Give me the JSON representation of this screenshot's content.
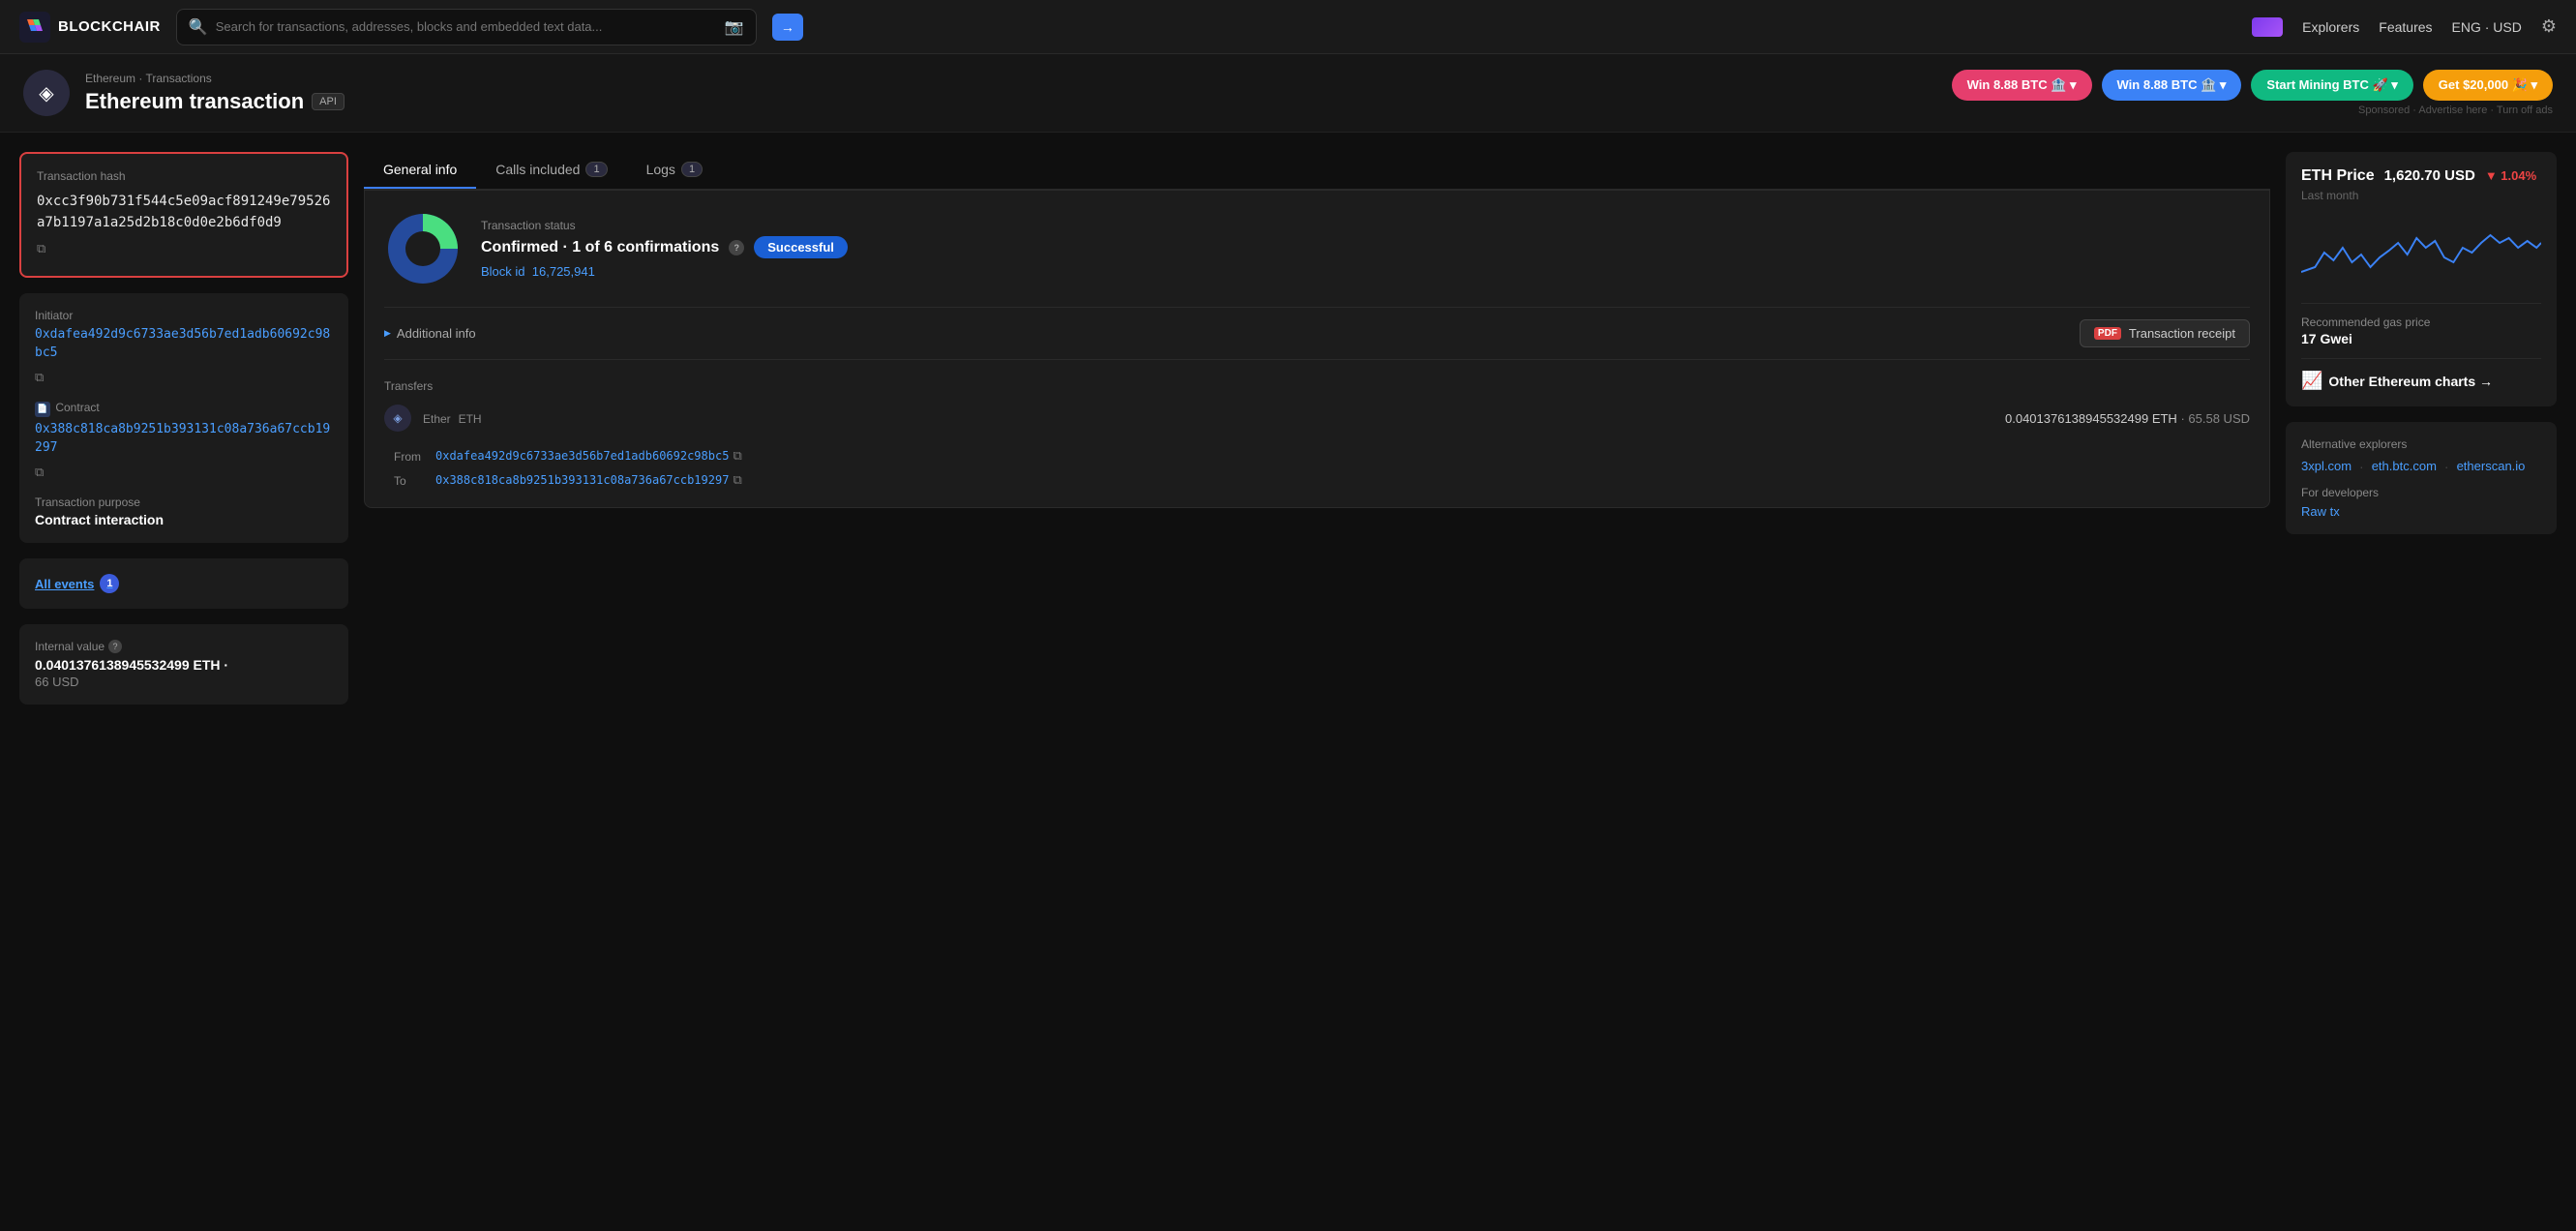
{
  "header": {
    "logo_text": "BLOCKCHAIR",
    "search_placeholder": "Search for transactions, addresses, blocks and embedded text data...",
    "search_btn_arrow": "→",
    "nav": {
      "explorers": "Explorers",
      "features": "Features",
      "lang_currency": "ENG · USD"
    }
  },
  "page_header": {
    "breadcrumb_chain": "Ethereum",
    "breadcrumb_sep": "·",
    "breadcrumb_page": "Transactions",
    "title": "Ethereum transaction",
    "api_badge": "API",
    "promo": [
      {
        "label": "Win 8.88 BTC 🏦 ▾",
        "style": "red"
      },
      {
        "label": "Win 8.88 BTC 🏦 ▾",
        "style": "blue"
      },
      {
        "label": "Start Mining BTC 🚀 ▾",
        "style": "green"
      },
      {
        "label": "Get $20,000 🎉 ▾",
        "style": "orange"
      }
    ],
    "sponsored_text": "Sponsored · Advertise here · Turn off ads"
  },
  "left": {
    "tx_hash_label": "Transaction hash",
    "tx_hash": "0xcc3f90b731f544c5e09acf891249e79526a7b1197a1a25d2b18c0d0e2b6df0d9",
    "initiator_label": "Initiator",
    "initiator_address": "0xdafea492d9c6733ae3d56b7ed1adb60692c98bc5",
    "contract_label": "Contract",
    "contract_address": "0x388c818ca8b9251b393131c08a736a67ccb19297",
    "tx_purpose_label": "Transaction purpose",
    "tx_purpose": "Contract interaction",
    "all_events_label": "All events",
    "all_events_count": "1",
    "internal_value_label": "Internal value",
    "internal_value_help": "?",
    "internal_eth": "0.0401376138945532499 ETH ·",
    "internal_usd": "66 USD"
  },
  "center": {
    "tabs": [
      {
        "label": "General info",
        "badge": null,
        "active": true
      },
      {
        "label": "Calls included",
        "badge": "1",
        "active": false
      },
      {
        "label": "Logs",
        "badge": "1",
        "active": false
      }
    ],
    "status_label": "Transaction status",
    "status_text": "Confirmed · 1 of 6 confirmations",
    "status_help": "?",
    "status_badge": "Successful",
    "block_id_label": "Block id",
    "block_id": "16,725,941",
    "additional_info_label": "Additional info",
    "receipt_btn": "Transaction receipt",
    "transfers_label": "Transfers",
    "ether_label": "Ether",
    "ether_ticker": "ETH",
    "ether_amount": "0.0401376138945532499 ETH",
    "ether_usd": "65.58 USD",
    "from_label": "From",
    "from_address": "0xdafea492d9c6733ae3d56b7ed1adb60692c98bc5",
    "to_label": "To",
    "to_address": "0x388c818ca8b9251b393131c08a736a67ccb19297"
  },
  "right": {
    "eth_price_title": "ETH Price",
    "eth_price_value": "1,620.70 USD",
    "eth_price_change": "▼ 1.04%",
    "price_period": "Last month",
    "gas_label": "Recommended gas price",
    "gas_value": "17 Gwei",
    "other_charts_label": "Other Ethereum charts →",
    "alt_explorers_label": "Alternative explorers",
    "alt_links": [
      "3xpl.com",
      "eth.btc.com",
      "etherscan.io"
    ],
    "for_devs_label": "For developers",
    "raw_tx_label": "Raw tx"
  }
}
